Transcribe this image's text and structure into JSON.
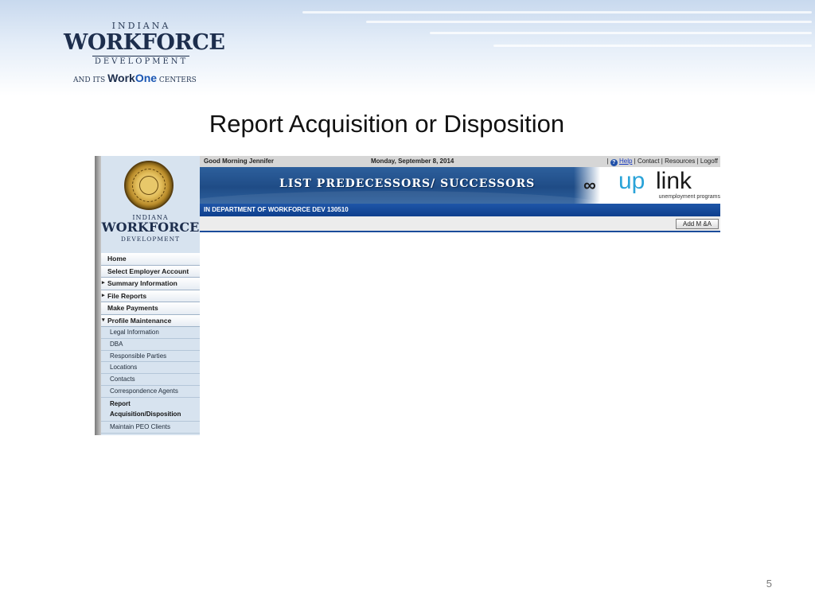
{
  "slide": {
    "brand": {
      "indiana": "INDIANA",
      "workforce": "WORKFORCE",
      "development": "DEVELOPMENT",
      "and_its": "AND ITS",
      "work": "Work",
      "one": "One",
      "centers": "CENTERS"
    },
    "title": "Report Acquisition or Disposition",
    "page_number": "5"
  },
  "app": {
    "topbar": {
      "greeting": "Good Morning Jennifer",
      "date": "Monday, September 8, 2014",
      "sep": "|",
      "help_glyph": "?",
      "help": "Help",
      "contact": "Contact",
      "resources": "Resources",
      "logoff": "Logoff"
    },
    "banner": {
      "page_heading": "LIST PREDECESSORS/ SUCCESSORS",
      "logo_rings": "∞",
      "logo_up": "up",
      "logo_link": "link",
      "logo_tagline": "unemployment programs"
    },
    "account_bar": "IN DEPARTMENT OF WORKFORCE DEV   130510",
    "add_button": "Add M &A",
    "sidebar": {
      "indiana": "INDIANA",
      "workforce": "WORKFORCE",
      "development": "DEVELOPMENT",
      "menu": [
        {
          "label": "Home",
          "arrow": ""
        },
        {
          "label": "Select Employer Account",
          "arrow": ""
        },
        {
          "label": "Summary Information",
          "arrow": "▸"
        },
        {
          "label": "File Reports",
          "arrow": "▸"
        },
        {
          "label": "Make Payments",
          "arrow": ""
        },
        {
          "label": "Profile Maintenance",
          "arrow": "▾"
        }
      ],
      "submenu": [
        "Legal Information",
        "DBA",
        "Responsible Parties",
        "Locations",
        "Contacts",
        "Correspondence Agents",
        "Report Acquisition/Disposition",
        "Maintain PEO Clients"
      ]
    }
  },
  "colors": {
    "banner_blue": "#1f4c86",
    "account_bar_blue": "#0f3f8d",
    "sidebar_bg": "#d7e3ef",
    "logo_accent": "#2aa3d8"
  }
}
